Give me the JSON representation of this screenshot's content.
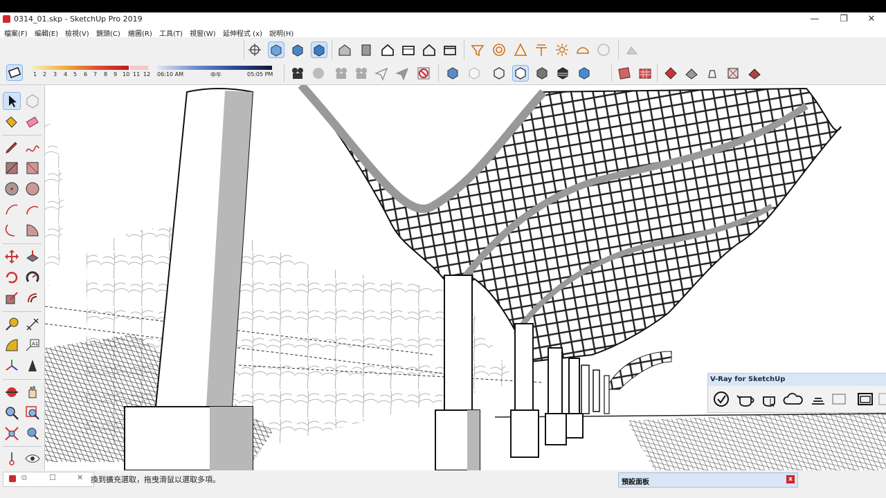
{
  "window": {
    "title": "0314_01.skp - SketchUp Pro 2019",
    "minimize": "—",
    "restore": "❐",
    "close": "✕"
  },
  "menu": [
    "檔案(F)",
    "編輯(E)",
    "檢視(V)",
    "鏡頭(C)",
    "繪圖(R)",
    "工具(T)",
    "視窗(W)",
    "延伸程式 (x)",
    "說明(H)"
  ],
  "shadow": {
    "months": [
      "1",
      "2",
      "3",
      "4",
      "5",
      "6",
      "7",
      "8",
      "9",
      "10",
      "11",
      "12"
    ],
    "time_start": "06:10 AM",
    "time_mid": "中午",
    "time_end": "05:05 PM"
  },
  "vray": {
    "title": "V-Ray for SketchUp"
  },
  "status": {
    "hint": "換到擴充選取，拖曳滑鼠以選取多項。",
    "tray_title": "預設面板",
    "tray_close": "x"
  },
  "colors": {
    "accent": "#cfe2f7",
    "vray_header": "#d8e6f5",
    "close_red": "#d0282c"
  }
}
